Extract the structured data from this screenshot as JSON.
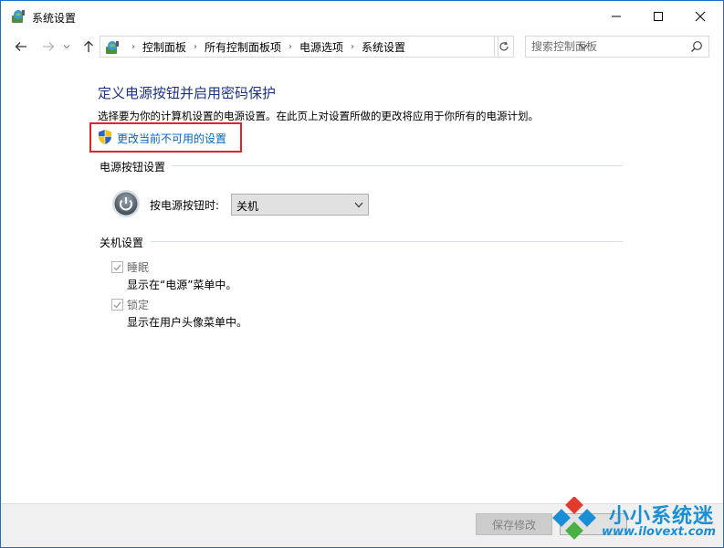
{
  "window": {
    "title": "系统设置",
    "controls": {
      "minimize_icon": "minimize-icon",
      "maximize_icon": "maximize-icon",
      "close_icon": "close-icon"
    }
  },
  "nav": {
    "breadcrumbs": [
      "控制面板",
      "所有控制面板项",
      "电源选项",
      "系统设置"
    ],
    "search_placeholder": "搜索控制面板"
  },
  "content": {
    "heading": "定义电源按钮并启用密码保护",
    "description": "选择要为你的计算机设置的电源设置。在此页上对设置所做的更改将应用于你所有的电源计划。",
    "change_link": "更改当前不可用的设置",
    "power_section": {
      "title": "电源按钮设置",
      "label": "按电源按钮时:",
      "selected": "关机"
    },
    "shutdown_section": {
      "title": "关机设置",
      "items": [
        {
          "label": "睡眠",
          "desc": "显示在“电源”菜单中。",
          "checked": true
        },
        {
          "label": "锁定",
          "desc": "显示在用户头像菜单中。",
          "checked": true
        }
      ]
    }
  },
  "footer": {
    "save_label": "保存修改"
  },
  "watermark": {
    "title": "小小系统迷",
    "url": "www.ilovext.com"
  },
  "colors": {
    "heading": "#1e3287",
    "link": "#0066cc",
    "highlight": "#e3232c",
    "watermark": "#1a8fd6"
  }
}
